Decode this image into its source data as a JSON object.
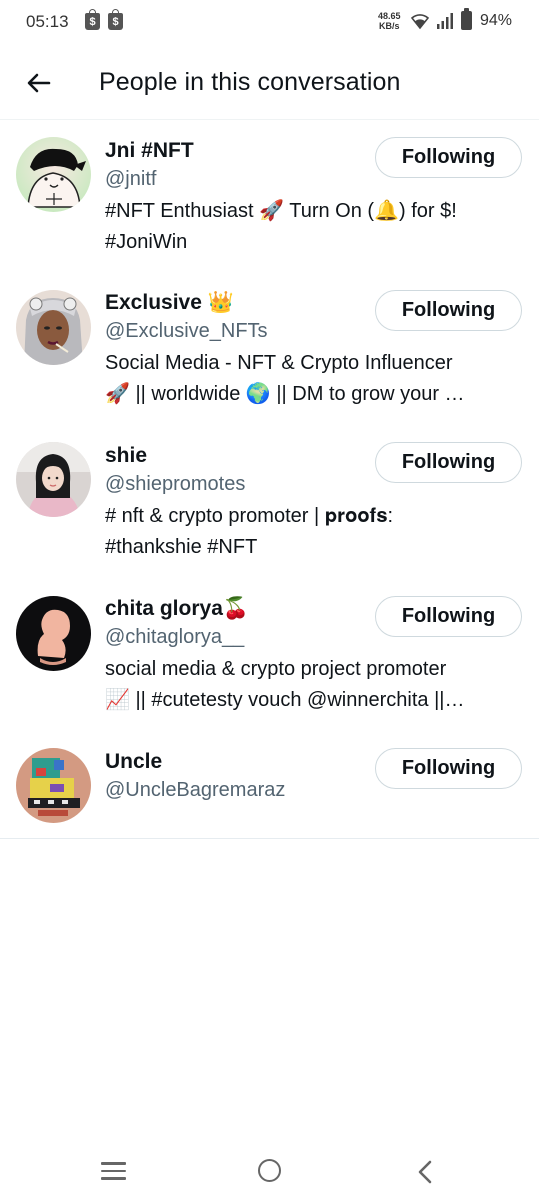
{
  "status_bar": {
    "time": "05:13",
    "net_speed_value": "48.65",
    "net_speed_unit": "KB/s",
    "battery": "94%",
    "notification_icons": [
      "shop-icon",
      "shop-icon"
    ]
  },
  "header": {
    "title": "People in this conversation",
    "back_icon": "arrow-left-icon"
  },
  "users": [
    {
      "name": "Jni #NFT",
      "name_emoji": "",
      "handle": "@jnitf",
      "button": "Following",
      "bio_lines": [
        "#NFT Enthusiast 🚀 Turn On (🔔) for $!",
        "#JoniWin"
      ]
    },
    {
      "name": "Exclusive",
      "name_emoji": "👑",
      "handle": "@Exclusive_NFTs",
      "button": "Following",
      "bio_lines": [
        "Social Media - NFT & Crypto Influencer",
        "🚀 || worldwide 🌍 || DM to grow your …"
      ]
    },
    {
      "name": "shie",
      "name_emoji": "",
      "handle": "@shiepromotes",
      "button": "Following",
      "bio_lines": [
        "# nft & crypto promoter | 𝐩𝐫𝐨𝐨𝐟𝐬:",
        "#thankshie #NFT"
      ]
    },
    {
      "name": "chita glorya",
      "name_emoji": "🍒",
      "handle": "@chitaglorya__",
      "button": "Following",
      "bio_lines": [
        "social media & crypto project promoter",
        "📈 || #cutetesty vouch @winnerchita ||…"
      ]
    },
    {
      "name": "Uncle",
      "name_emoji": "",
      "handle": "@UncleBagremaraz",
      "button": "Following",
      "bio_lines": []
    }
  ],
  "nav_bar": {
    "icons": [
      "menu-icon",
      "home-circle-icon",
      "back-chevron-icon"
    ]
  },
  "colors": {
    "text_primary": "#0f1419",
    "text_secondary": "#536471",
    "button_border": "#cfd9de",
    "divider": "#eff3f4"
  }
}
